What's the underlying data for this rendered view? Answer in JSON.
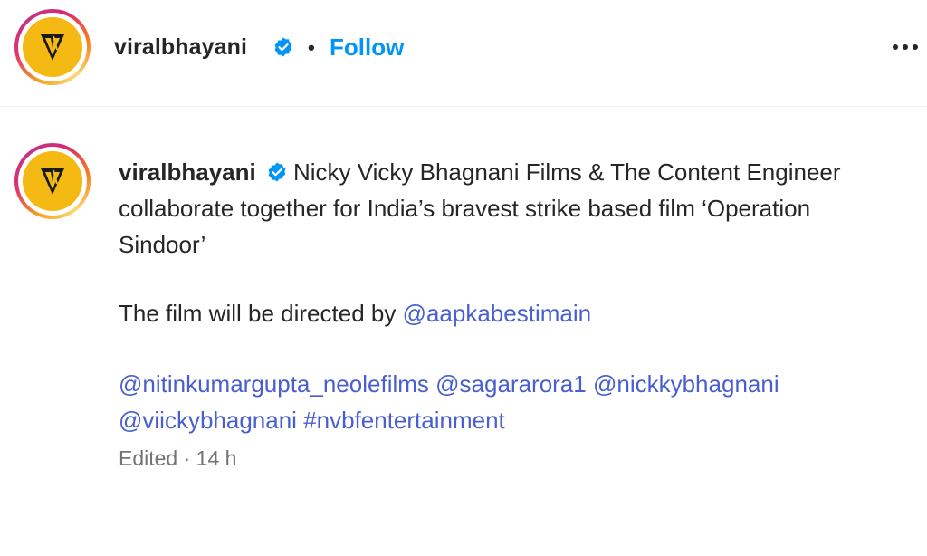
{
  "post_header": {
    "username": "viralbhayani",
    "separator": "•",
    "follow_label": "Follow",
    "more_icon": "more-horizontal-icon"
  },
  "caption": {
    "username": "viralbhayani",
    "line1_text": "Nicky Vicky Bhagnani Films & The Content Engineer",
    "line2_text": "collaborate together for India’s bravest strike based film ‘Operation",
    "line3_text": "Sindoor’",
    "directed_prefix": "The film will be directed by ",
    "director_mention": "@aapkabestimain",
    "tags": [
      "@nitinkumargupta_neolefilms",
      "@sagararora1",
      "@nickkybhagnani",
      "@viickybhagnani",
      "#nvbfentertainment"
    ],
    "meta": "Edited · 14 h"
  },
  "colors": {
    "follow": "#0095f6",
    "mention": "#4a5fcf",
    "verified": "#0095f6",
    "avatar_bg": "#f4b912"
  }
}
